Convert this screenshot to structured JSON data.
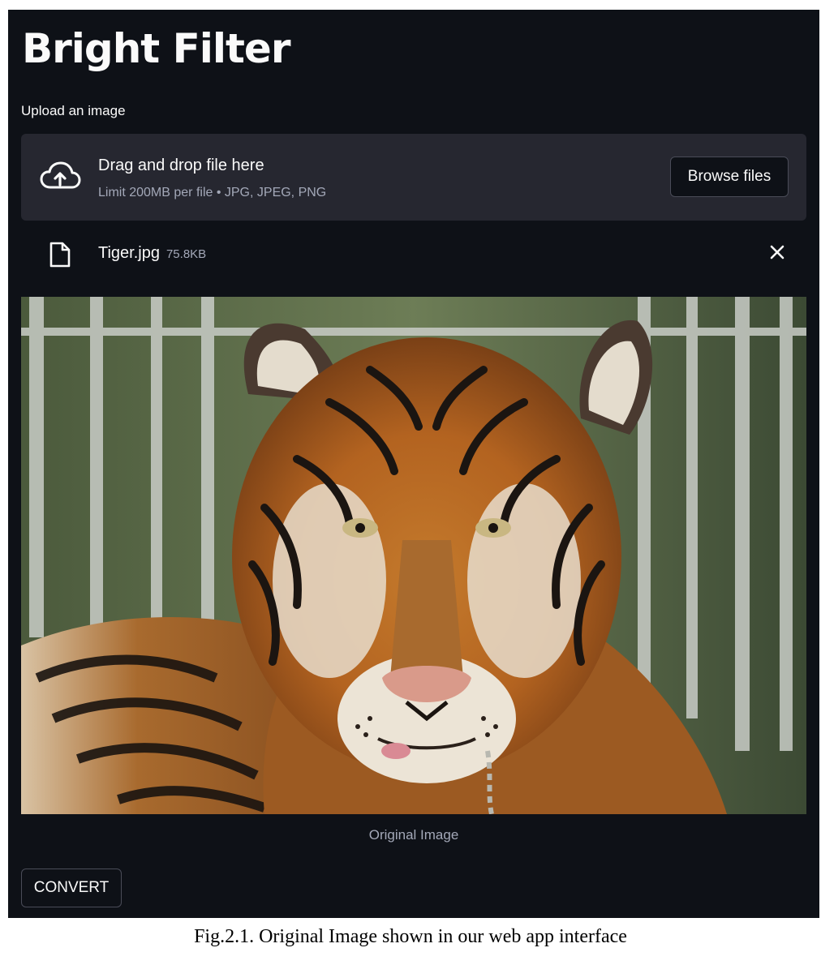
{
  "app": {
    "title": "Bright Filter",
    "upload_label": "Upload an image",
    "dropzone": {
      "main_text": "Drag and drop file here",
      "sub_text": "Limit 200MB per file • JPG, JPEG, PNG",
      "browse_label": "Browse files",
      "icon": "cloud-upload-icon"
    },
    "uploaded_file": {
      "name": "Tiger.jpg",
      "size": "75.8KB",
      "icon": "file-icon",
      "remove_icon": "close-icon"
    },
    "image_caption": "Original Image",
    "convert_label": "CONVERT",
    "colors": {
      "background": "#0e1117",
      "panel": "#262730",
      "text": "#fafafa",
      "muted": "#a3a8b8"
    }
  },
  "figure_caption": "Fig.2.1. Original Image shown in our web app interface"
}
